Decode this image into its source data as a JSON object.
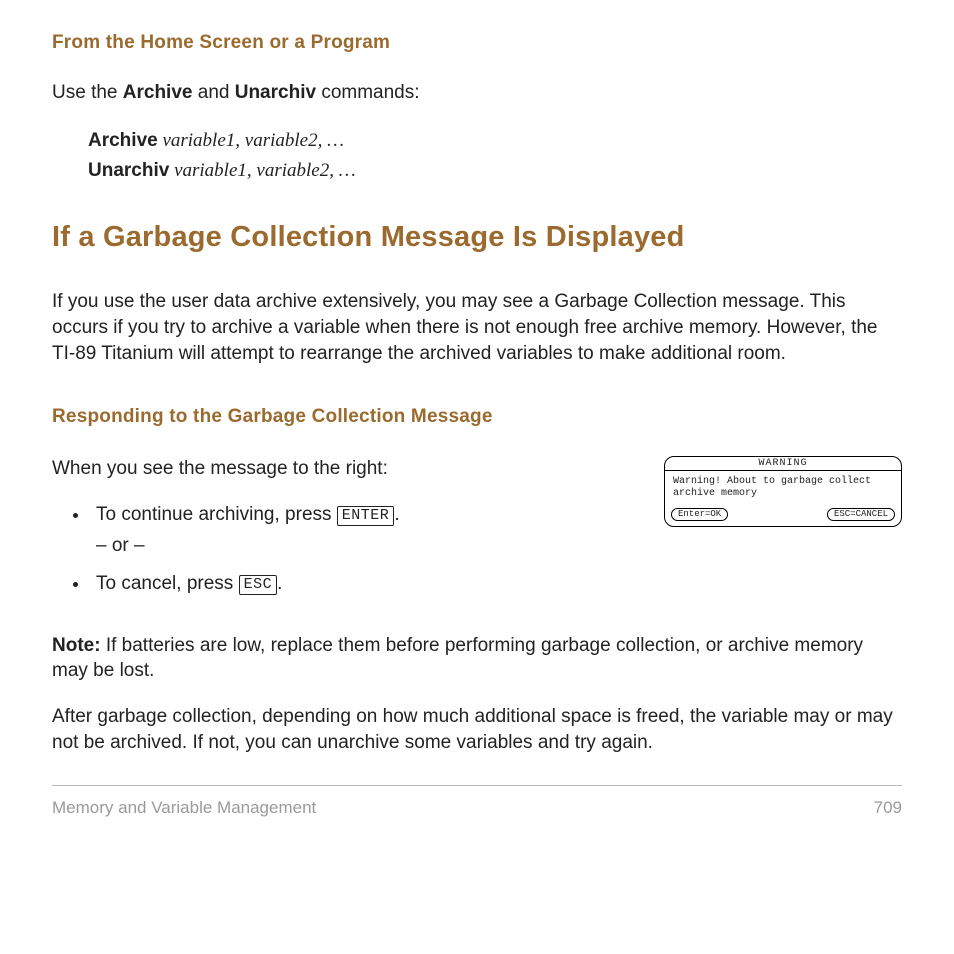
{
  "section1": {
    "heading": "From the Home Screen or a Program",
    "intro_pre": "Use the ",
    "intro_kw1": "Archive",
    "intro_mid": " and ",
    "intro_kw2": "Unarchiv",
    "intro_post": " commands:",
    "cmd1_name": "Archive",
    "cmd1_args": " variable1, variable2, …",
    "cmd2_name": "Unarchiv",
    "cmd2_args": " variable1, variable2, …"
  },
  "section2": {
    "heading": "If a Garbage Collection Message Is Displayed",
    "para1": "If you use the user data archive extensively, you may see a Garbage Collection message. This occurs if you try to archive a variable when there is not enough free archive memory. However, the TI-89 Titanium will attempt to rearrange the archived variables to make additional room."
  },
  "section3": {
    "heading": "Responding to the Garbage Collection Message",
    "lead": "When you see the message to the right:",
    "bullet1_pre": "To continue archiving, press ",
    "bullet1_key": "ENTER",
    "bullet1_post": ".",
    "or_text": "– or –",
    "bullet2_pre": "To cancel, press ",
    "bullet2_key": "ESC",
    "bullet2_post": ".",
    "dialog": {
      "title": "WARNING",
      "body": "Warning! About to garbage collect archive memory",
      "btn_ok": "Enter=OK",
      "btn_cancel": "ESC=CANCEL"
    },
    "note_label": "Note:",
    "note_text": " If batteries are low, replace them before performing garbage collection, or archive memory may be lost.",
    "after": "After garbage collection, depending on how much additional space is freed, the variable may or may not be archived. If not, you can unarchive some variables and try again."
  },
  "footer": {
    "chapter": "Memory and Variable Management",
    "page": "709"
  }
}
